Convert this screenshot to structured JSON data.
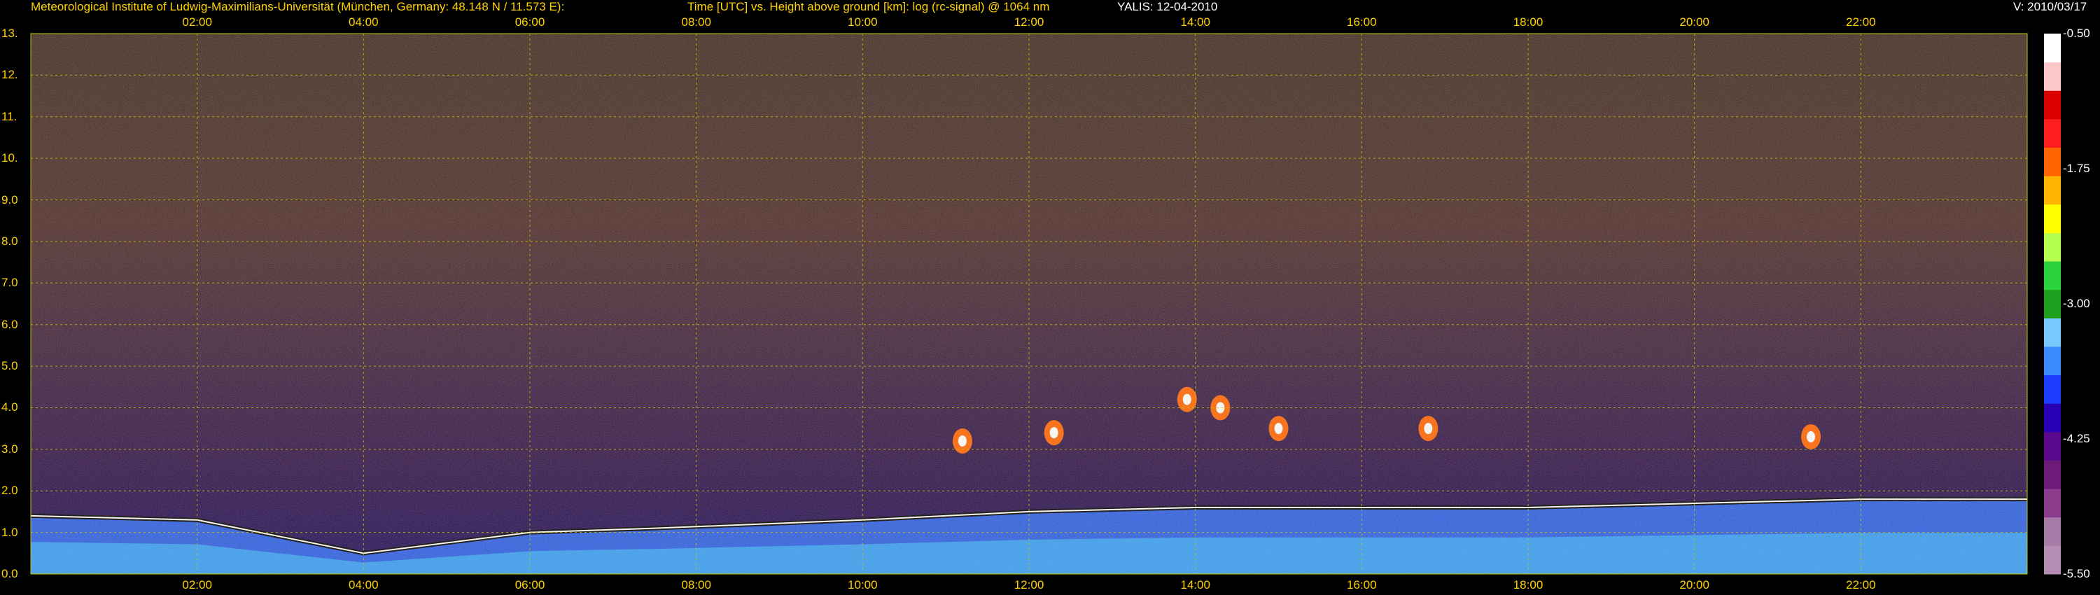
{
  "header": {
    "institute": "Meteorological Institute of Ludwig-Maximilians-Universität (München, Germany: 48.148 N / 11.573 E):",
    "axes_desc": "Time [UTC] vs. Height above ground [km]: log (rc-signal) @ 1064 nm",
    "instrument_date": "YALIS: 12-04-2010",
    "version": "V: 2010/03/17"
  },
  "chart_data": {
    "type": "heatmap",
    "title": "Time [UTC] vs. Height above ground [km]: log (rc-signal) @ 1064 nm",
    "x_ticks": [
      "02:00",
      "04:00",
      "06:00",
      "08:00",
      "10:00",
      "12:00",
      "14:00",
      "16:00",
      "18:00",
      "20:00",
      "22:00"
    ],
    "x_tick_hours": [
      2,
      4,
      6,
      8,
      10,
      12,
      14,
      16,
      18,
      20,
      22
    ],
    "xlim_hours": [
      0.0,
      24.0
    ],
    "y_ticks": [
      "13.",
      "12.",
      "11.",
      "10.",
      "9.0",
      "8.0",
      "7.0",
      "6.0",
      "5.0",
      "4.0",
      "3.0",
      "2.0",
      "1.0",
      "0.0"
    ],
    "y_tick_values": [
      13,
      12,
      11,
      10,
      9,
      8,
      7,
      6,
      5,
      4,
      3,
      2,
      1,
      0
    ],
    "ylim_km": [
      0,
      13
    ],
    "colorbar": {
      "ticks": [
        "-0.50",
        "-1.75",
        "-3.00",
        "-4.25",
        "-5.50"
      ],
      "tick_values": [
        -0.5,
        -1.75,
        -3.0,
        -4.25,
        -5.5
      ],
      "range": [
        -5.5,
        -0.5
      ],
      "colors": [
        "#b48cb4",
        "#a67ba8",
        "#8c3c8c",
        "#6e1a78",
        "#5a0a8c",
        "#2a00b4",
        "#1e3cff",
        "#3c8cff",
        "#78c8ff",
        "#1ea01e",
        "#2ad23c",
        "#b4ff50",
        "#ffff00",
        "#ffb400",
        "#ff6400",
        "#ff1e1e",
        "#dc0000",
        "#ffc8c8",
        "#ffffff"
      ]
    },
    "grid": true,
    "description_features": {
      "boundary_layer_height_km_by_hour": [
        [
          0.0,
          1.4
        ],
        [
          2.0,
          1.3
        ],
        [
          4.0,
          0.5
        ],
        [
          6.0,
          1.0
        ],
        [
          7.5,
          1.1
        ],
        [
          10.0,
          1.3
        ],
        [
          12.0,
          1.5
        ],
        [
          14.0,
          1.6
        ],
        [
          16.0,
          1.6
        ],
        [
          18.0,
          1.6
        ],
        [
          20.0,
          1.7
        ],
        [
          22.0,
          1.8
        ],
        [
          24.0,
          1.8
        ]
      ],
      "cloud_patches": [
        [
          11.2,
          3.2
        ],
        [
          12.3,
          3.4
        ],
        [
          13.9,
          4.2
        ],
        [
          14.3,
          4.0
        ],
        [
          15.0,
          3.5
        ],
        [
          16.8,
          3.5
        ],
        [
          21.4,
          3.3
        ]
      ]
    }
  }
}
